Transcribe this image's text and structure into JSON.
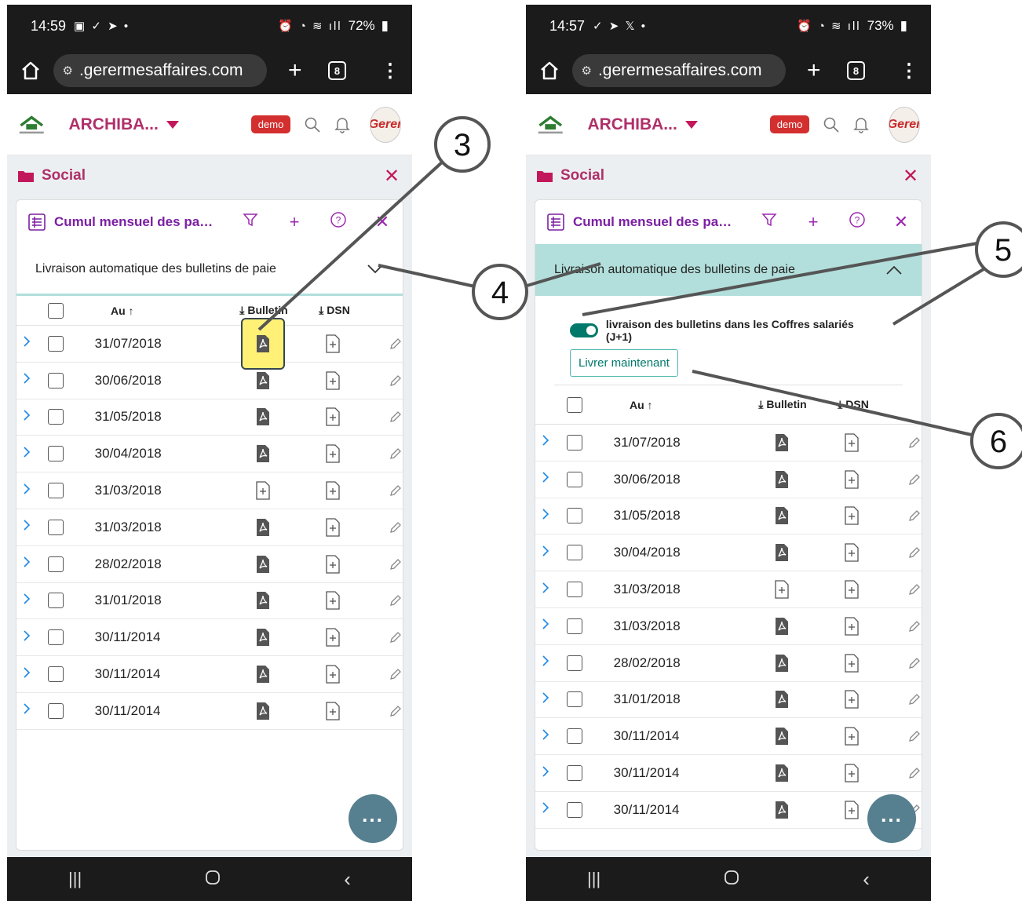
{
  "left": {
    "status": {
      "time": "14:59",
      "battery": "72%"
    },
    "browser": {
      "url": ".gerermesaffaires.com",
      "tab_count": "8"
    },
    "header": {
      "app_name": "ARCHIBA...",
      "badge": "demo",
      "avatar_text": "Gerer"
    },
    "workspace": {
      "title": "Social"
    },
    "card": {
      "title": "Cumul mensuel des paies ...",
      "accordion_label": "Livraison automatique des bulletins de paie",
      "columns": {
        "date": "Au",
        "bulletin": "Bulletin",
        "dsn": "DSN"
      },
      "rows": [
        {
          "date": "31/07/2018",
          "bulletin": "pdf"
        },
        {
          "date": "30/06/2018",
          "bulletin": "pdf"
        },
        {
          "date": "31/05/2018",
          "bulletin": "pdf"
        },
        {
          "date": "30/04/2018",
          "bulletin": "pdf"
        },
        {
          "date": "31/03/2018",
          "bulletin": "add"
        },
        {
          "date": "31/03/2018",
          "bulletin": "pdf"
        },
        {
          "date": "28/02/2018",
          "bulletin": "pdf"
        },
        {
          "date": "31/01/2018",
          "bulletin": "pdf"
        },
        {
          "date": "30/11/2014",
          "bulletin": "pdf"
        },
        {
          "date": "30/11/2014",
          "bulletin": "pdf"
        },
        {
          "date": "30/11/2014",
          "bulletin": "pdf"
        }
      ]
    }
  },
  "right": {
    "status": {
      "time": "14:57",
      "battery": "73%"
    },
    "browser": {
      "url": ".gerermesaffaires.com",
      "tab_count": "8"
    },
    "header": {
      "app_name": "ARCHIBA...",
      "badge": "demo",
      "avatar_text": "Gerer"
    },
    "workspace": {
      "title": "Social"
    },
    "card": {
      "title": "Cumul mensuel des paies ...",
      "accordion_label": "Livraison automatique des bulletins de paie",
      "toggle_label": "livraison des bulletins dans les Coffres salariés (J+1)",
      "deliver_button": "Livrer maintenant",
      "columns": {
        "date": "Au",
        "bulletin": "Bulletin",
        "dsn": "DSN"
      },
      "rows": [
        {
          "date": "31/07/2018",
          "bulletin": "pdf"
        },
        {
          "date": "30/06/2018",
          "bulletin": "pdf"
        },
        {
          "date": "31/05/2018",
          "bulletin": "pdf"
        },
        {
          "date": "30/04/2018",
          "bulletin": "pdf"
        },
        {
          "date": "31/03/2018",
          "bulletin": "add"
        },
        {
          "date": "31/03/2018",
          "bulletin": "pdf"
        },
        {
          "date": "28/02/2018",
          "bulletin": "pdf"
        },
        {
          "date": "31/01/2018",
          "bulletin": "pdf"
        },
        {
          "date": "30/11/2014",
          "bulletin": "pdf"
        },
        {
          "date": "30/11/2014",
          "bulletin": "pdf"
        },
        {
          "date": "30/11/2014",
          "bulletin": "pdf"
        }
      ]
    }
  },
  "callouts": [
    "3",
    "4",
    "5",
    "6"
  ],
  "colors": {
    "brand": "#b0306a",
    "accent_teal": "#b2dfdb",
    "highlight": "#fff176",
    "fab": "#56808f"
  }
}
